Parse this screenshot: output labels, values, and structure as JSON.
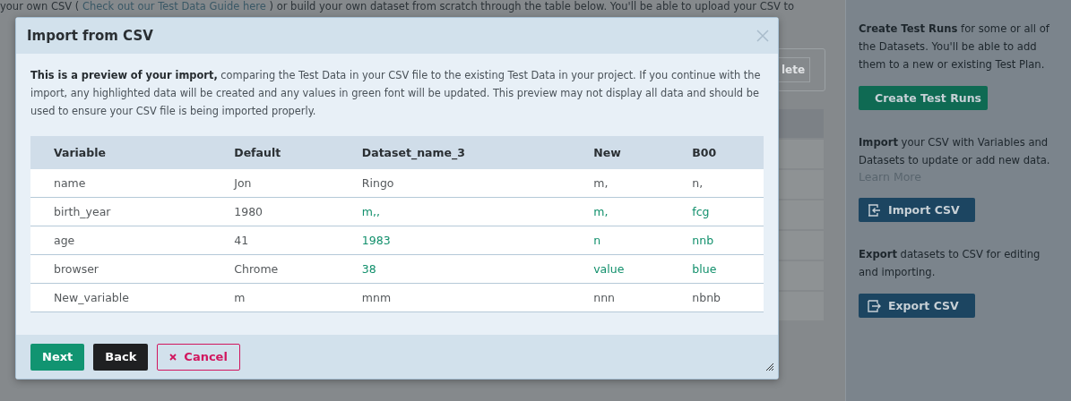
{
  "page": {
    "intro_before": "your own CSV ( ",
    "intro_link": "Check out our Test Data Guide here",
    "intro_after": " ) or build your own dataset from scratch through the table below. You'll be able to upload your CSV to",
    "delete_button": "lete"
  },
  "sidebar": {
    "sections": [
      {
        "text": "**Create Test Runs** for some or all of the Datasets. You'll be able to add them to a new or existing Test Plan.",
        "button": "Create Test Runs",
        "kind": "create"
      },
      {
        "text": "**Import** your CSV with Variables and Datasets to update or add new data.",
        "link": "Learn More",
        "button": "Import CSV",
        "kind": "import"
      },
      {
        "text": "**Export** datasets to CSV for editing and importing.",
        "button": "Export CSV",
        "kind": "export"
      }
    ]
  },
  "dialog": {
    "title": "Import from CSV",
    "intro": "**This is a preview of your import,** comparing the Test Data in your CSV file to the existing Test Data in your project. If you continue with the import, any highlighted data will be created and any values in green font will be updated. This preview may not display all data and should be used to ensure your CSV file is being imported properly.",
    "table": {
      "columns": [
        "Variable",
        "Default",
        "Dataset_name_3",
        "New",
        "B00"
      ],
      "rows": [
        [
          {
            "text": "name",
            "updated": false
          },
          {
            "text": "Jon",
            "updated": false
          },
          {
            "text": "Ringo",
            "updated": false
          },
          {
            "text": "m,",
            "updated": false
          },
          {
            "text": "n,",
            "updated": false
          }
        ],
        [
          {
            "text": "birth_year",
            "updated": false
          },
          {
            "text": "1980",
            "updated": false
          },
          {
            "text": "m,,",
            "updated": true
          },
          {
            "text": "m,",
            "updated": true
          },
          {
            "text": "fcg",
            "updated": true
          }
        ],
        [
          {
            "text": "age",
            "updated": false
          },
          {
            "text": "41",
            "updated": false
          },
          {
            "text": "1983",
            "updated": true
          },
          {
            "text": "n",
            "updated": true
          },
          {
            "text": "nnb",
            "updated": true
          }
        ],
        [
          {
            "text": "browser",
            "updated": false
          },
          {
            "text": "Chrome",
            "updated": false
          },
          {
            "text": "38",
            "updated": true
          },
          {
            "text": "value",
            "updated": true
          },
          {
            "text": "blue",
            "updated": true
          }
        ],
        [
          {
            "text": "New_variable",
            "updated": false
          },
          {
            "text": "m",
            "updated": false
          },
          {
            "text": "mnm",
            "updated": false
          },
          {
            "text": "nnn",
            "updated": false
          },
          {
            "text": "nbnb",
            "updated": false
          }
        ]
      ]
    },
    "buttons": [
      {
        "label": "Next",
        "kind": "primary"
      },
      {
        "label": "Back",
        "kind": "dark"
      },
      {
        "label": "Cancel",
        "kind": "cancel"
      }
    ]
  }
}
